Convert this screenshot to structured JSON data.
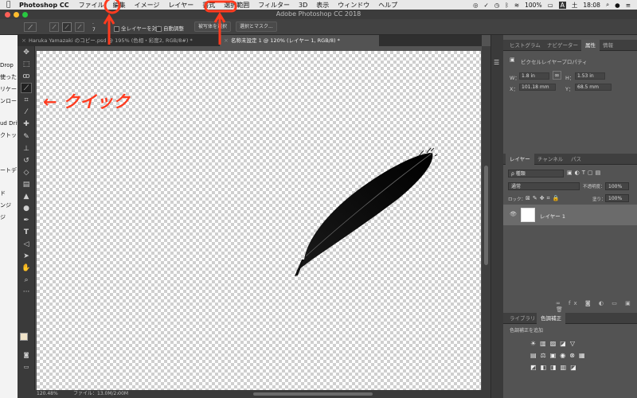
{
  "menubar": {
    "app_name": "Photoshop CC",
    "items": [
      "ファイル",
      "編集",
      "イメージ",
      "レイヤー",
      "書式",
      "選択範囲",
      "フィルター",
      "3D",
      "表示",
      "ウィンドウ",
      "ヘルプ"
    ],
    "battery": "100%",
    "input_indicator": "A",
    "day": "土",
    "time": "18:08"
  },
  "window": {
    "title": "Adobe Photoshop CC 2018"
  },
  "options_bar": {
    "sample_all_layers": "全レイヤーを対象",
    "auto_enhance": "自動調整",
    "select_subject": "被写体を選択",
    "select_and_mask": "選択とマスク..."
  },
  "tabs": [
    {
      "label": "Haruka Yamazaki のコピー.psd @ 195% (色相・彩度2, RGB/8#) *",
      "active": false
    },
    {
      "label": "名称未設定 1 @ 120% (レイヤー 1, RGB/8) *",
      "active": true
    }
  ],
  "background_window_items": [
    "Drop",
    "使った",
    "リケー",
    "ンロー",
    "ud Driv",
    "クトッ",
    "ートデ",
    "ド",
    "ンジ",
    "ジ"
  ],
  "annotation": {
    "text": "← クイック",
    "color": "#ff3b1f"
  },
  "status": {
    "zoom": "120.48%",
    "file": "ファイル：13.0M/2.00M"
  },
  "top_panel": {
    "tabs": [
      "ヒストグラム",
      "ナビゲーター",
      "属性",
      "情報"
    ],
    "active_tab": "属性",
    "title": "ピクセルレイヤープロパティ",
    "w_label": "W：",
    "w": "1.8 in",
    "h_label": "H：",
    "h": "1.53 in",
    "x_label": "X：",
    "x": "101.18 mm",
    "y_label": "Y：",
    "y": "68.5 mm"
  },
  "layers_panel": {
    "tabs": [
      "レイヤー",
      "チャンネル",
      "パス"
    ],
    "filter": "ρ 種類",
    "blend_mode": "通常",
    "opacity_label": "不透明度：",
    "opacity": "100%",
    "lock_label": "ロック：",
    "fill_label": "塗り：",
    "fill": "100%",
    "layer_name": "レイヤー 1"
  },
  "bottom_panel": {
    "tabs": [
      "ライブラリ",
      "色調補正"
    ],
    "active_tab": "色調補正",
    "subtitle": "色調補正を追加"
  }
}
